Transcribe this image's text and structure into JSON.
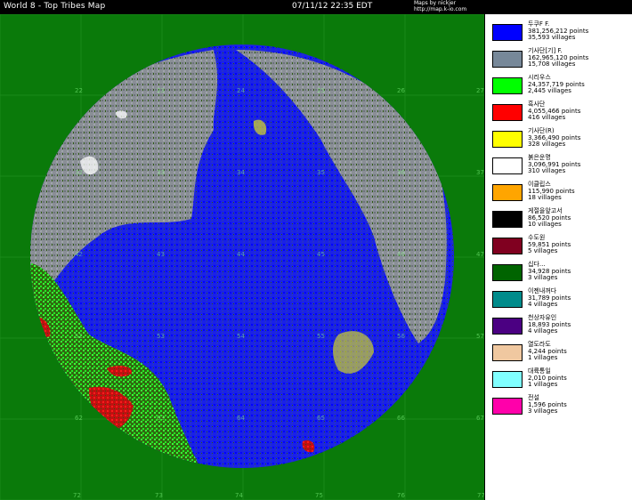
{
  "header": {
    "title": "World 8  -  Top Tribes Map",
    "datetime": "07/11/12 22:35 EDT",
    "credit_line1": "Maps by nickjer",
    "credit_line2": "http://map.k-io.com"
  },
  "map": {
    "background_color": "#0a7a0a",
    "circle_fill": "#2a5e0a",
    "grid_line_color": "#1a8a1a",
    "x_labels": [
      "72",
      "73",
      "74",
      "75",
      "76",
      "77"
    ],
    "y_labels_left": [
      "22",
      "32",
      "42",
      "52",
      "62"
    ],
    "y_labels_right": [
      "27",
      "37",
      "47",
      "57",
      "67"
    ],
    "inner_labels": [
      "23",
      "24",
      "25",
      "26",
      "33",
      "34",
      "35",
      "36",
      "43",
      "44",
      "45",
      "46",
      "53",
      "54",
      "55",
      "56",
      "63",
      "64",
      "65",
      "66"
    ]
  },
  "legend": [
    {
      "name": "두쿠F F.",
      "points": "381,256,212 points",
      "villages": "35,593 villages",
      "color": "#0000ff"
    },
    {
      "name": "기사단[기] F.",
      "points": "162,965,120 points",
      "villages": "15,708 villages",
      "color": "#778899"
    },
    {
      "name": "시리우스",
      "points": "24,357,719 points",
      "villages": "2,445 villages",
      "color": "#00ff00"
    },
    {
      "name": "흑사단",
      "points": "4,055,466 points",
      "villages": "416 villages",
      "color": "#ff0000"
    },
    {
      "name": "기사단(R)",
      "points": "3,366,490 points",
      "villages": "328 villages",
      "color": "#ffff00"
    },
    {
      "name": "붉은운명",
      "points": "3,096,991 points",
      "villages": "310 villages",
      "color": "#ffffff"
    },
    {
      "name": "이클립스",
      "points": "115,990 points",
      "villages": "18 villages",
      "color": "#ffa500"
    },
    {
      "name": "게절을앞고서",
      "points": "86,520 points",
      "villages": "10 villages",
      "color": "#000000"
    },
    {
      "name": "수도원",
      "points": "59,851 points",
      "villages": "5 villages",
      "color": "#800020"
    },
    {
      "name": "십다...",
      "points": "34,928 points",
      "villages": "3 villages",
      "color": "#006400"
    },
    {
      "name": "이젠내꺼다",
      "points": "31,789 points",
      "villages": "4 villages",
      "color": "#008b8b"
    },
    {
      "name": "천상자유인",
      "points": "18,893 points",
      "villages": "4 villages",
      "color": "#4b0082"
    },
    {
      "name": "열도라도",
      "points": "4,244 points",
      "villages": "1 villages",
      "color": "#f0c8a0"
    },
    {
      "name": "대륙통일",
      "points": "2,010 points",
      "villages": "1 villages",
      "color": "#80ffff"
    },
    {
      "name": "전설",
      "points": "1,596 points",
      "villages": "3 villages",
      "color": "#ff00aa"
    }
  ]
}
